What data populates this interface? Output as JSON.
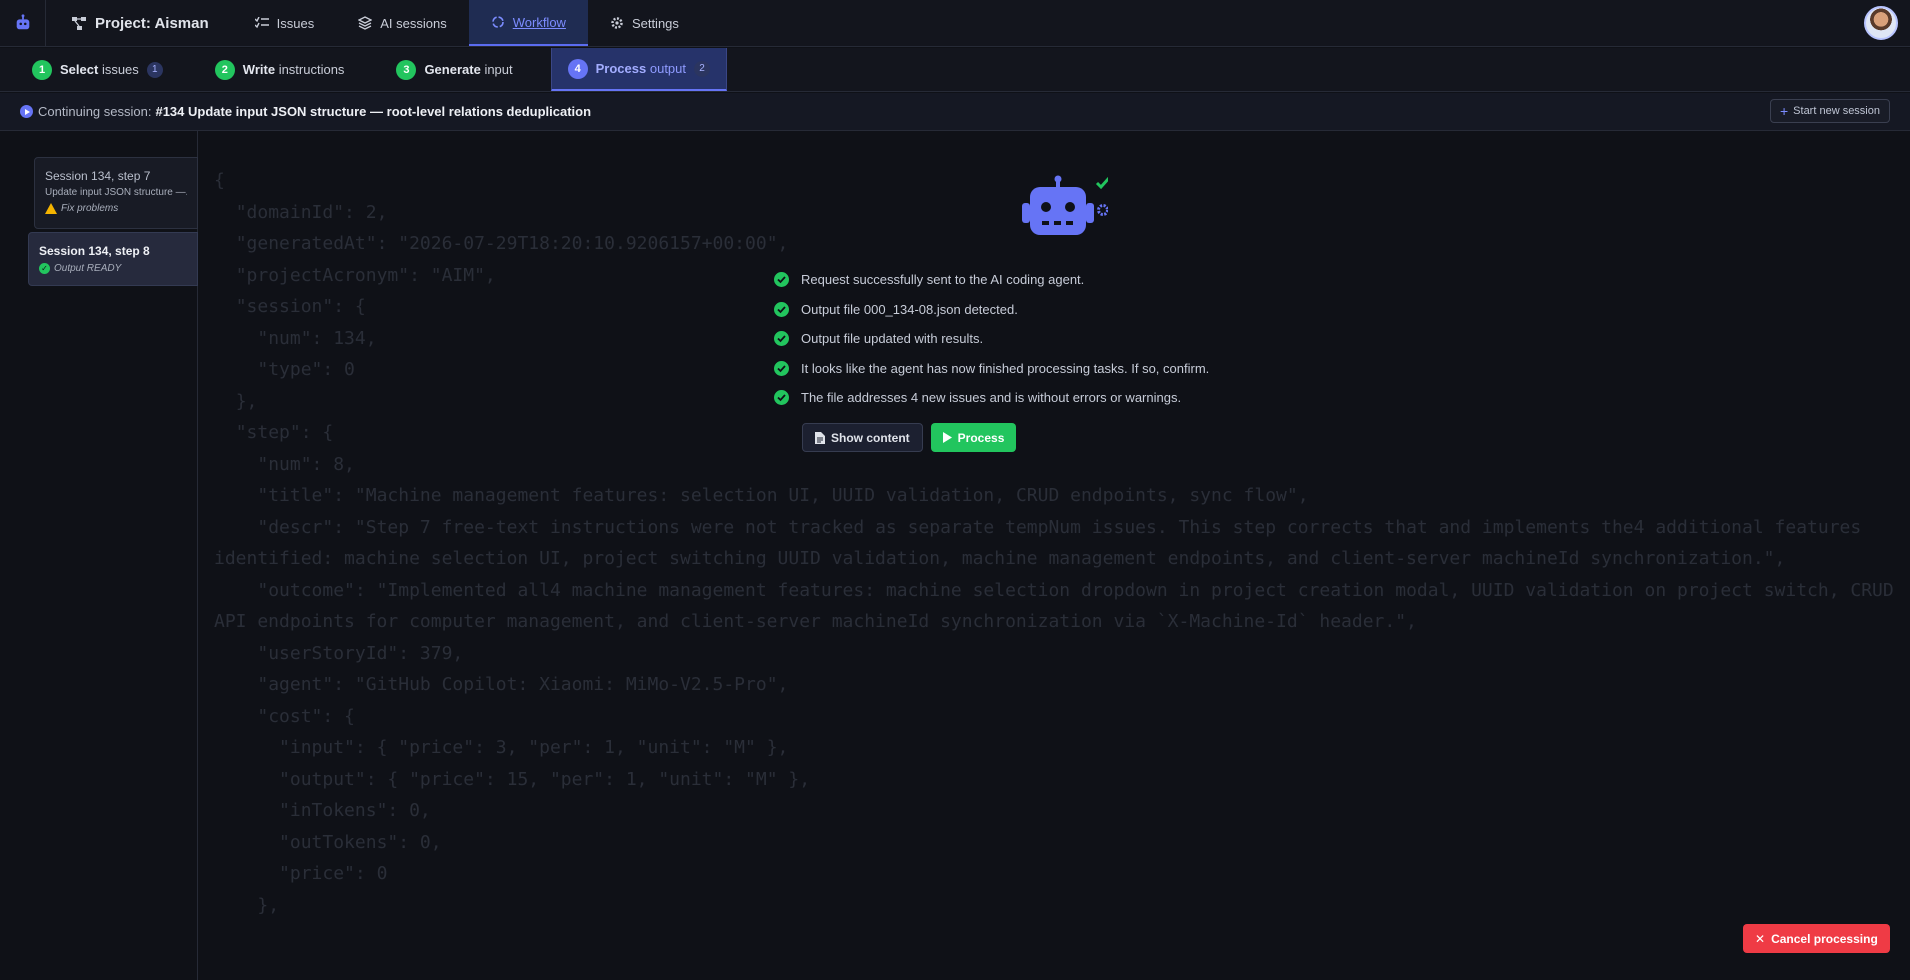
{
  "nav": {
    "project": "Project: Aisman",
    "issues": "Issues",
    "ai_sessions": "AI sessions",
    "workflow": "Workflow",
    "settings": "Settings"
  },
  "steps": [
    {
      "num": "1",
      "strong": "Select",
      "rest": "issues",
      "count": "1"
    },
    {
      "num": "2",
      "strong": "Write",
      "rest": "instructions",
      "count": ""
    },
    {
      "num": "3",
      "strong": "Generate",
      "rest": "input",
      "count": ""
    },
    {
      "num": "4",
      "strong": "Process",
      "rest": "output",
      "count": "2"
    }
  ],
  "session_bar": {
    "prefix": "Continuing session:",
    "title": "#134 Update input JSON structure — root-level relations deduplication",
    "new_session": "Start new session"
  },
  "sidebar": {
    "items": [
      {
        "title": "Session 134, step 7",
        "desc": "Update input JSON structure —...",
        "status": "Fix problems"
      },
      {
        "title": "Session 134, step 8",
        "status": "Output READY"
      }
    ]
  },
  "checklist": [
    "Request successfully sent to the AI coding agent.",
    "Output file 000_134-08.json detected.",
    "Output file updated with results.",
    "It looks like the agent has now finished processing tasks. If so, confirm.",
    "The file addresses 4 new issues and is without errors or warnings."
  ],
  "buttons": {
    "show_content": "Show content",
    "process": "Process",
    "cancel": "Cancel processing"
  },
  "code": "{\n  \"domainId\": 2,\n  \"generatedAt\": \"2026-07-29T18:20:10.9206157+00:00\",\n  \"projectAcronym\": \"AIM\",\n  \"session\": {\n    \"num\": 134,\n    \"type\": 0\n  },\n  \"step\": {\n    \"num\": 8,\n    \"title\": \"Machine management features: selection UI, UUID validation, CRUD endpoints, sync flow\",\n    \"descr\": \"Step 7 free-text instructions were not tracked as separate tempNum issues. This step corrects that and implements the4 additional features identified: machine selection UI, project switching UUID validation, machine management endpoints, and client-server machineId synchronization.\",\n    \"outcome\": \"Implemented all4 machine management features: machine selection dropdown in project creation modal, UUID validation on project switch, CRUD API endpoints for computer management, and client-server machineId synchronization via `X-Machine-Id` header.\",\n    \"userStoryId\": 379,\n    \"agent\": \"GitHub Copilot: Xiaomi: MiMo-V2.5-Pro\",\n    \"cost\": {\n      \"input\": { \"price\": 3, \"per\": 1, \"unit\": \"M\" },\n      \"output\": { \"price\": 15, \"per\": 1, \"unit\": \"M\" },\n      \"inTokens\": 0,\n      \"outTokens\": 0,\n      \"price\": 0\n    },",
  "colors": {
    "accent": "#6674f5",
    "success": "#22c55e",
    "danger": "#ef3b45",
    "warning": "#f5b400"
  }
}
